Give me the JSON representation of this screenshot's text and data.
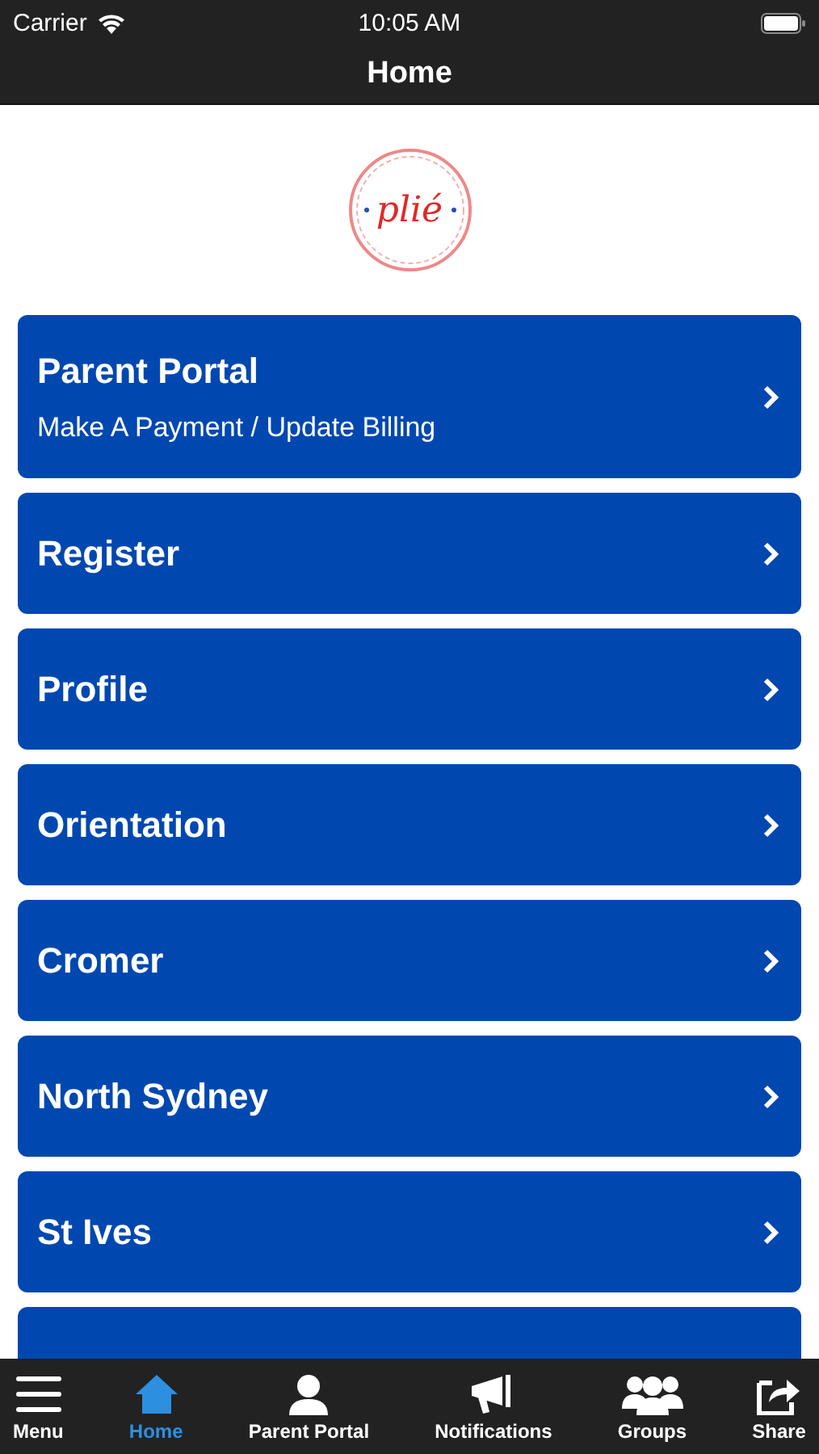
{
  "status_bar": {
    "carrier": "Carrier",
    "time": "10:05 AM"
  },
  "nav": {
    "title": "Home"
  },
  "logo": {
    "text": "plié"
  },
  "items": [
    {
      "title": "Parent Portal",
      "subtitle": "Make A Payment / Update Billing"
    },
    {
      "title": "Register"
    },
    {
      "title": "Profile"
    },
    {
      "title": "Orientation"
    },
    {
      "title": "Cromer"
    },
    {
      "title": "North Sydney"
    },
    {
      "title": "St Ives"
    }
  ],
  "tab_bar": [
    {
      "label": "Menu",
      "kind": "menu",
      "selected": false
    },
    {
      "label": "Home",
      "kind": "home",
      "selected": true
    },
    {
      "label": "Parent Portal",
      "kind": "person",
      "selected": false
    },
    {
      "label": "Notifications",
      "kind": "megaphone",
      "selected": false
    },
    {
      "label": "Groups",
      "kind": "groups",
      "selected": false
    },
    {
      "label": "Share",
      "kind": "share",
      "selected": false
    }
  ]
}
